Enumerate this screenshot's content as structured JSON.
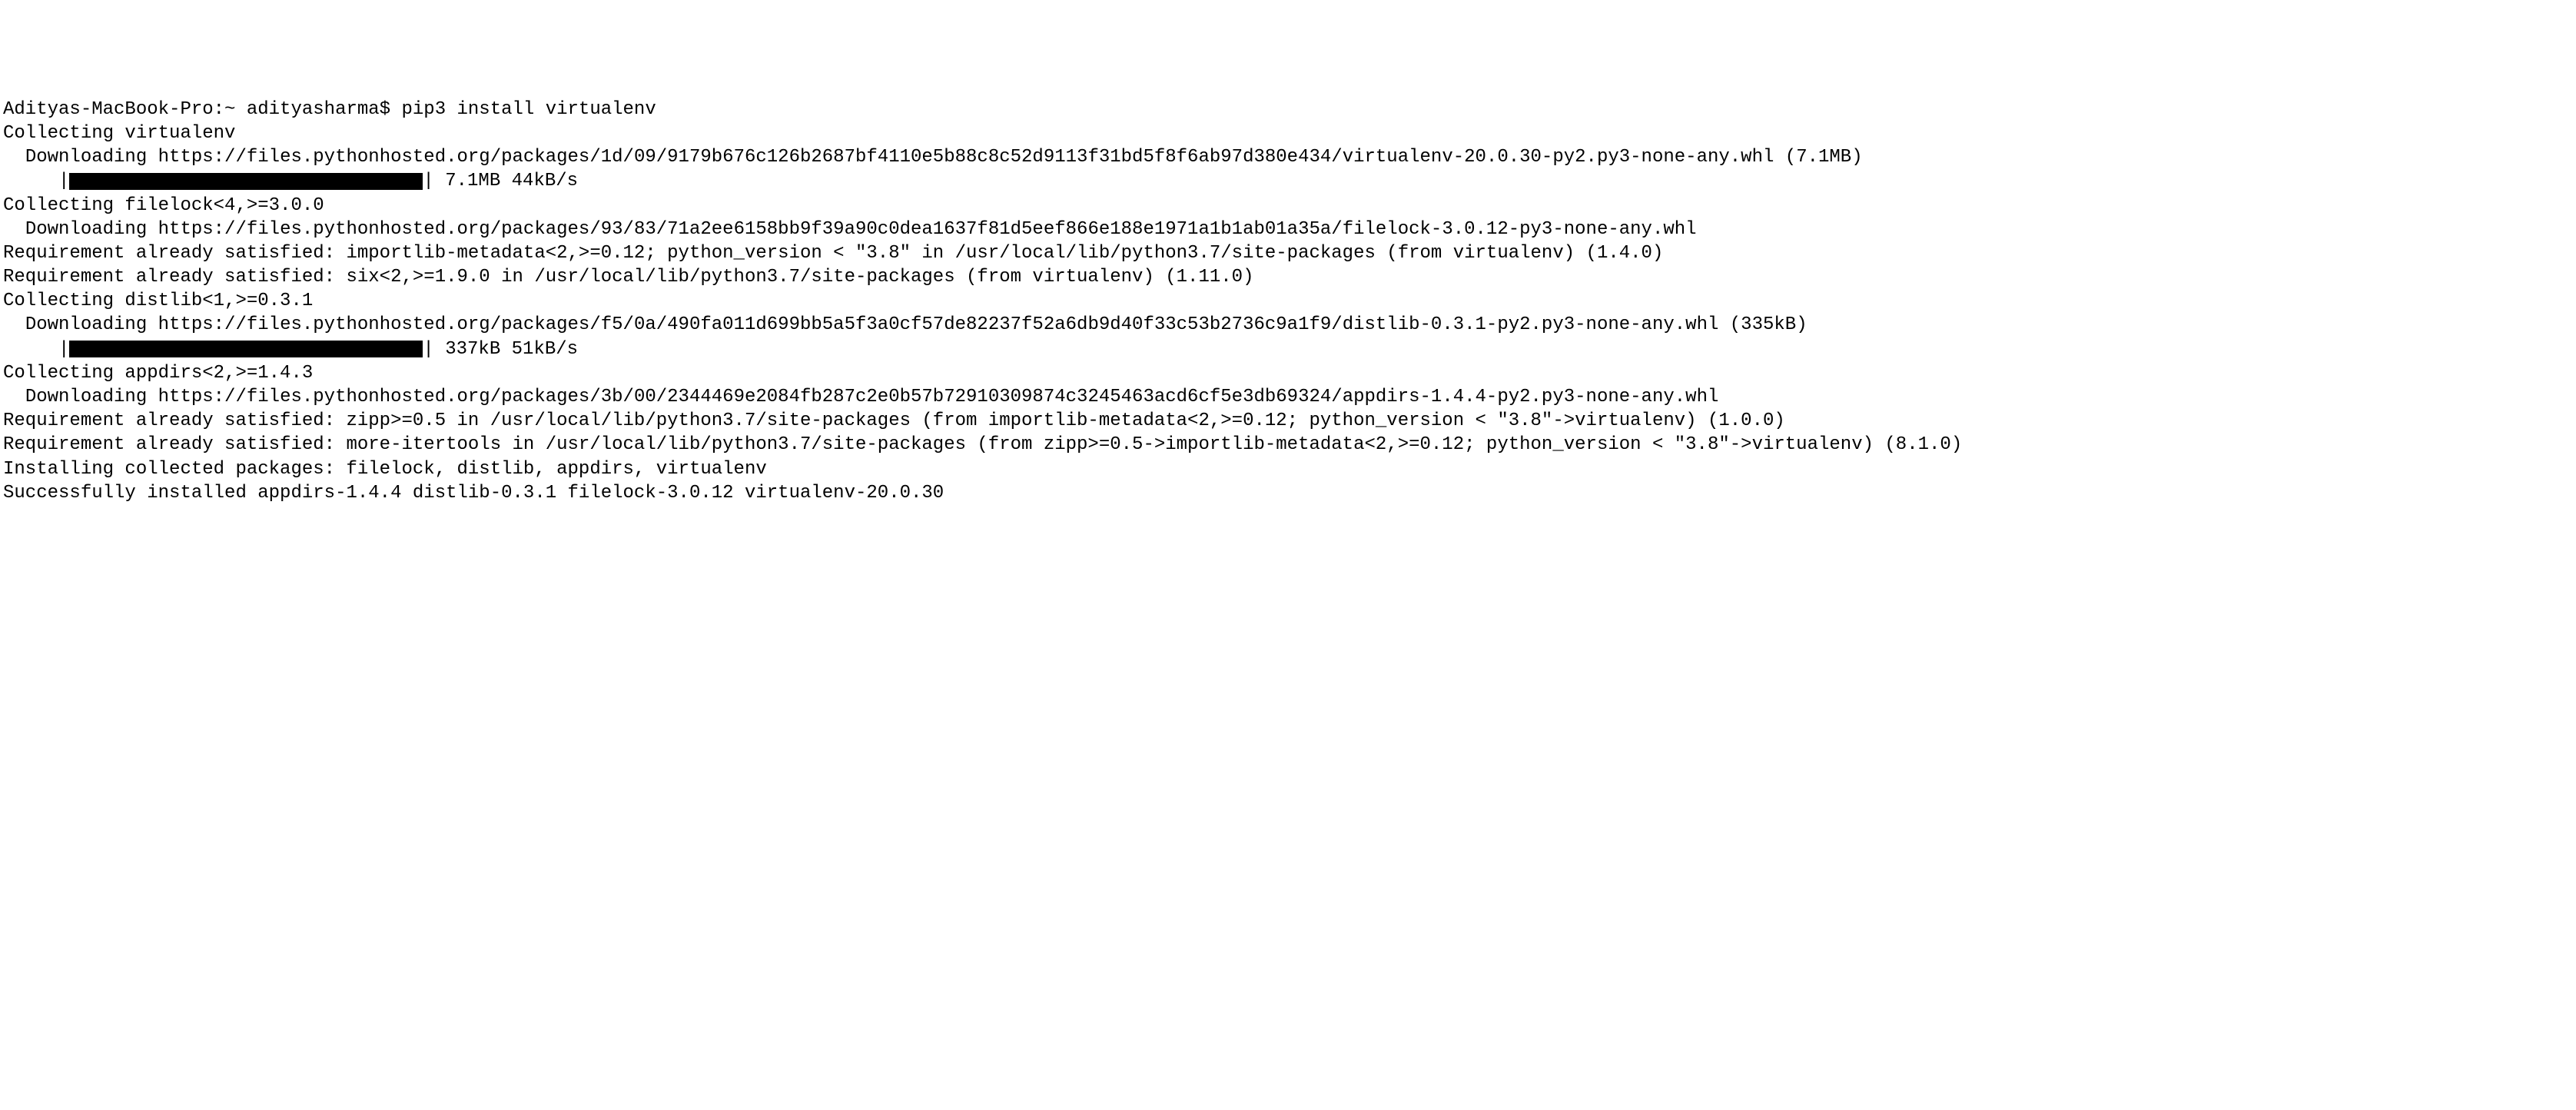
{
  "terminal": {
    "prompt": "Adityas-MacBook-Pro:~ adityasharma$ ",
    "command": "pip3 install virtualenv",
    "lines": {
      "collecting_virtualenv": "Collecting virtualenv",
      "downloading_virtualenv": "  Downloading https://files.pythonhosted.org/packages/1d/09/9179b676c126b2687bf4110e5b88c8c52d9113f31bd5f8f6ab97d380e434/virtualenv-20.0.30-py2.py3-none-any.whl (7.1MB)",
      "progress1_prefix": "     |",
      "progress1_suffix": "| 7.1MB 44kB/s",
      "collecting_filelock": "Collecting filelock<4,>=3.0.0",
      "downloading_filelock": "  Downloading https://files.pythonhosted.org/packages/93/83/71a2ee6158bb9f39a90c0dea1637f81d5eef866e188e1971a1b1ab01a35a/filelock-3.0.12-py3-none-any.whl",
      "req_importlib": "Requirement already satisfied: importlib-metadata<2,>=0.12; python_version < \"3.8\" in /usr/local/lib/python3.7/site-packages (from virtualenv) (1.4.0)",
      "req_six": "Requirement already satisfied: six<2,>=1.9.0 in /usr/local/lib/python3.7/site-packages (from virtualenv) (1.11.0)",
      "collecting_distlib": "Collecting distlib<1,>=0.3.1",
      "downloading_distlib": "  Downloading https://files.pythonhosted.org/packages/f5/0a/490fa011d699bb5a5f3a0cf57de82237f52a6db9d40f33c53b2736c9a1f9/distlib-0.3.1-py2.py3-none-any.whl (335kB)",
      "progress2_prefix": "     |",
      "progress2_suffix": "| 337kB 51kB/s",
      "collecting_appdirs": "Collecting appdirs<2,>=1.4.3",
      "downloading_appdirs": "  Downloading https://files.pythonhosted.org/packages/3b/00/2344469e2084fb287c2e0b57b72910309874c3245463acd6cf5e3db69324/appdirs-1.4.4-py2.py3-none-any.whl",
      "req_zipp": "Requirement already satisfied: zipp>=0.5 in /usr/local/lib/python3.7/site-packages (from importlib-metadata<2,>=0.12; python_version < \"3.8\"->virtualenv) (1.0.0)",
      "req_more_itertools": "Requirement already satisfied: more-itertools in /usr/local/lib/python3.7/site-packages (from zipp>=0.5->importlib-metadata<2,>=0.12; python_version < \"3.8\"->virtualenv) (8.1.0)",
      "installing": "Installing collected packages: filelock, distlib, appdirs, virtualenv",
      "success": "Successfully installed appdirs-1.4.4 distlib-0.3.1 filelock-3.0.12 virtualenv-20.0.30"
    }
  }
}
